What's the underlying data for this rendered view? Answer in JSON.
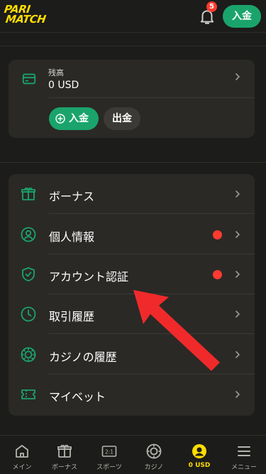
{
  "header": {
    "logo_line1": "PARI",
    "logo_line2": "MATCH",
    "notification_count": "5",
    "deposit_label": "入金"
  },
  "balance": {
    "label": "残高",
    "value": "0 USD",
    "deposit_label": "入金",
    "withdraw_label": "出金"
  },
  "menu": {
    "items": [
      {
        "label": "ボーナス",
        "icon": "gift-icon",
        "alert": false
      },
      {
        "label": "個人情報",
        "icon": "user-circle-icon",
        "alert": true
      },
      {
        "label": "アカウント認証",
        "icon": "shield-check-icon",
        "alert": true
      },
      {
        "label": "取引履歴",
        "icon": "clock-icon",
        "alert": false
      },
      {
        "label": "カジノの履歴",
        "icon": "casino-chip-icon",
        "alert": false
      },
      {
        "label": "マイベット",
        "icon": "ticket-icon",
        "alert": false
      }
    ]
  },
  "bottom_nav": {
    "items": [
      {
        "label": "メイン",
        "icon": "home-icon",
        "active": false
      },
      {
        "label": "ボーナス",
        "icon": "gift-icon",
        "active": false
      },
      {
        "label": "スポーツ",
        "icon": "scoreboard-icon",
        "active": false
      },
      {
        "label": "カジノ",
        "icon": "casino-chip-icon",
        "active": false
      },
      {
        "label": "0 USD",
        "icon": "account-icon",
        "active": true
      },
      {
        "label": "メニュー",
        "icon": "menu-icon",
        "active": false
      }
    ]
  },
  "colors": {
    "accent_green": "#1aa46b",
    "brand_yellow": "#ffdd00",
    "alert_red": "#ff3b30",
    "card_bg": "#2a2926",
    "page_bg": "#1c1c1a",
    "annotation_arrow": "#f02a2a"
  }
}
